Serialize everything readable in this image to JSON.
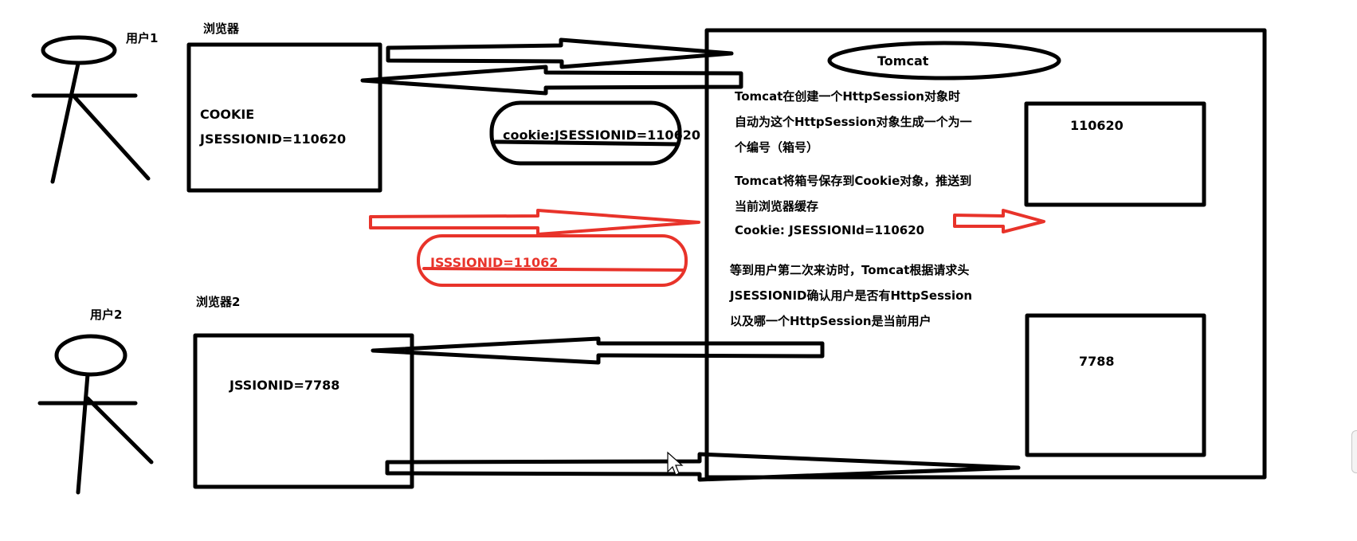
{
  "diagram": {
    "user1": {
      "label": "用户1",
      "browser_label": "浏览器",
      "cookie_title": "COOKIE",
      "cookie_value": "JSESSIONID=110620"
    },
    "request_cookie": "cookie:JSESSIONID=110620",
    "red_request": "JSSSIONID=11062",
    "user2": {
      "label": "用户2",
      "browser_label": "浏览器2",
      "cookie_value": "JSSIONID=7788"
    },
    "server": {
      "title": "Tomcat",
      "text_lines": [
        "Tomcat在创建一个HttpSession对象时",
        "自动为这个HttpSession对象生成一个为一",
        "个编号（箱号）",
        "Tomcat将箱号保存到Cookie对象，推送到",
        "当前浏览器缓存",
        "Cookie: JSESSIONId=110620",
        "等到用户第二次来访时，Tomcat根据请求头",
        "JSESSIONID确认用户是否有HttpSession",
        "以及哪一个HttpSession是当前用户"
      ],
      "session_box_1": "110620",
      "session_box_2": "7788"
    },
    "colors": {
      "ink": "#000000",
      "highlight": "#e8332a",
      "background": "#ffffff"
    }
  }
}
